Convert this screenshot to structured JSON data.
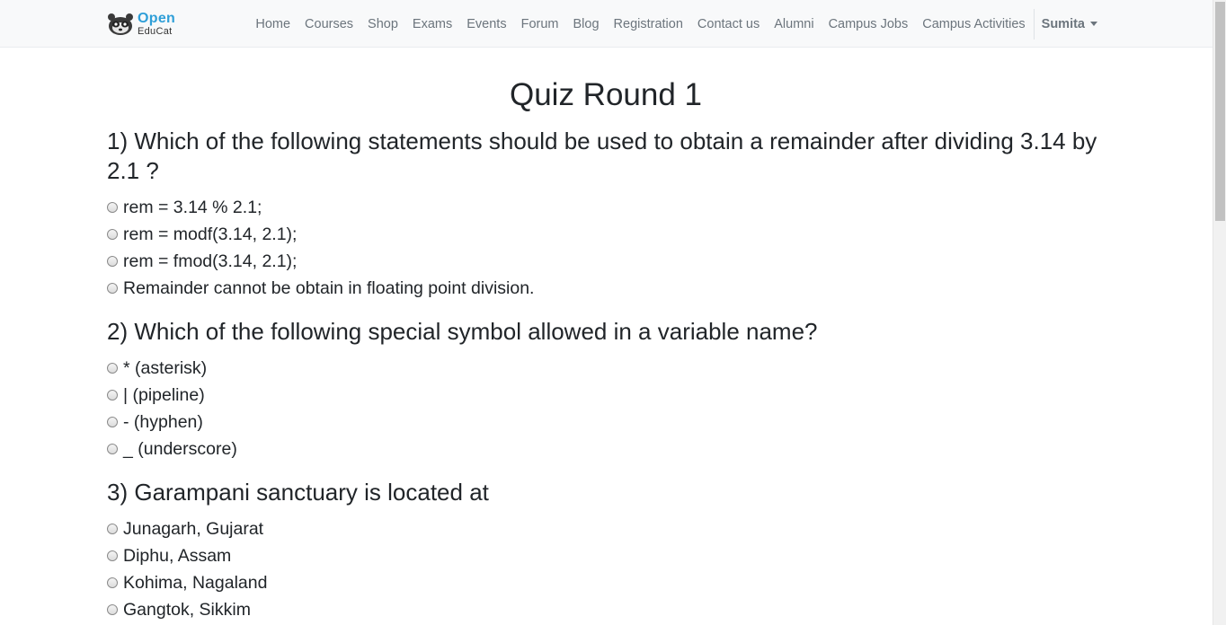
{
  "navbar": {
    "logo": {
      "open": "Open",
      "educat": "EduCat"
    },
    "links": [
      "Home",
      "Courses",
      "Shop",
      "Exams",
      "Events",
      "Forum",
      "Blog",
      "Registration",
      "Contact us",
      "Alumni",
      "Campus Jobs",
      "Campus Activities"
    ],
    "user": "Sumita"
  },
  "quiz": {
    "title": "Quiz Round 1",
    "questions": [
      {
        "text": "1) Which of the following statements should be used to obtain a remainder after dividing 3.14 by 2.1 ?",
        "options": [
          "rem = 3.14 % 2.1;",
          "rem = modf(3.14, 2.1);",
          "rem = fmod(3.14, 2.1);",
          "Remainder cannot be obtain in floating point division."
        ]
      },
      {
        "text": "2) Which of the following special symbol allowed in a variable name?",
        "options": [
          "* (asterisk)",
          "| (pipeline)",
          "- (hyphen)",
          "_ (underscore)"
        ]
      },
      {
        "text": "3) Garampani sanctuary is located at",
        "options": [
          "Junagarh, Gujarat",
          "Diphu, Assam",
          "Kohima, Nagaland",
          "Gangtok, Sikkim"
        ]
      }
    ]
  },
  "colors": {
    "brand": "#2f9fd8",
    "navbar_bg": "#f8f9fa",
    "nav_text": "#6c757d",
    "text": "#212529"
  },
  "icons": {
    "logo": "raccoon-logo-icon",
    "user_menu": "caret-down-icon"
  }
}
